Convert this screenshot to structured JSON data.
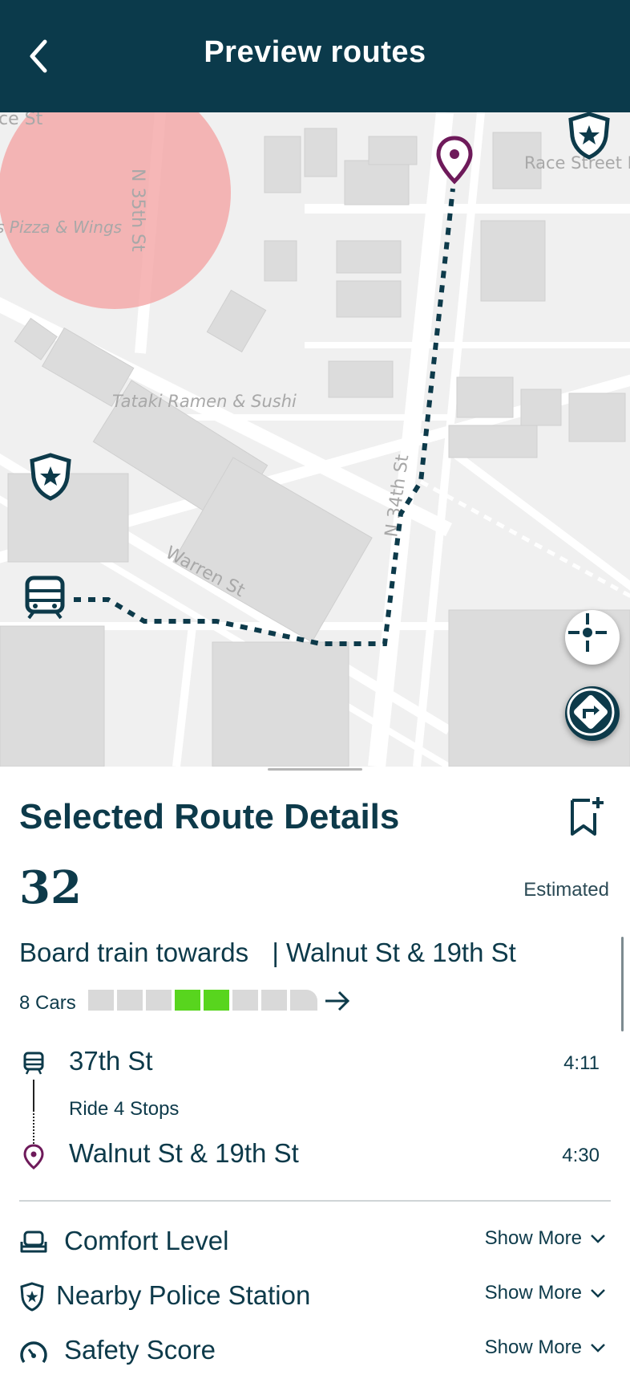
{
  "header": {
    "title": "Preview routes",
    "back_icon": "chevron-left-icon"
  },
  "map": {
    "street_labels": [
      "ce St",
      "N 35th St",
      "s Pizza & Wings",
      "Race Street L",
      "Tataki Ramen & Sushi",
      "N 34th St",
      "Warren St"
    ],
    "colors": {
      "route": "#0d3a4a",
      "destination_pin": "#6e1a5a",
      "highlight_circle": "#f4a5a5"
    }
  },
  "route": {
    "section_title": "Selected Route Details",
    "number": "32",
    "estimated_label": "Estimated",
    "board_text": "Board train towards",
    "destination_text": "| Walnut St & 19th St",
    "cars_label": "8 Cars",
    "cars_total": 8,
    "cars_highlighted": [
      3,
      4
    ],
    "car_colors": {
      "empty": "#d9d9d9",
      "highlight": "#58d51e"
    }
  },
  "stops": {
    "origin_name": "37th St",
    "origin_time": "4:11",
    "ride_text": "Ride 4 Stops",
    "destination_name": "Walnut St & 19th St",
    "destination_time": "4:30"
  },
  "info": [
    {
      "label": "Comfort Level",
      "action": "Show More",
      "icon": "seat-icon"
    },
    {
      "label": "Nearby Police Station",
      "action": "Show More",
      "icon": "police-shield-icon"
    },
    {
      "label": "Safety Score",
      "action": "Show More",
      "icon": "gauge-icon"
    }
  ]
}
